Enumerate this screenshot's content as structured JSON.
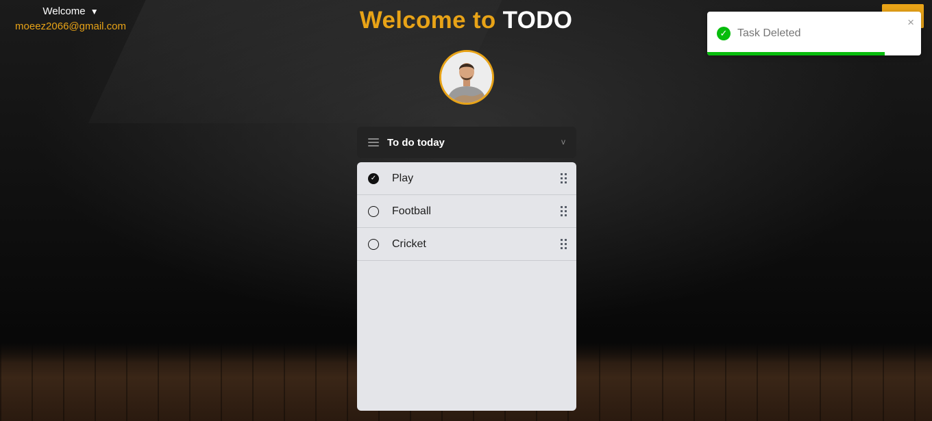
{
  "user_menu": {
    "welcome_label": "Welcome",
    "caret": "▼",
    "email": "moeez2066@gmail.com"
  },
  "header": {
    "title_prefix": "Welcome to",
    "title_app": "TODO"
  },
  "list": {
    "title": "To do today",
    "chevron": "v",
    "tasks": [
      {
        "label": "Play",
        "done": true
      },
      {
        "label": "Football",
        "done": false
      },
      {
        "label": "Cricket",
        "done": false
      }
    ]
  },
  "toast": {
    "message": "Task Deleted",
    "close": "×",
    "check": "✓",
    "progress": 0.83,
    "color": "#07bc0c"
  },
  "colors": {
    "accent": "#e8a317",
    "panel": "#e4e5e9"
  }
}
